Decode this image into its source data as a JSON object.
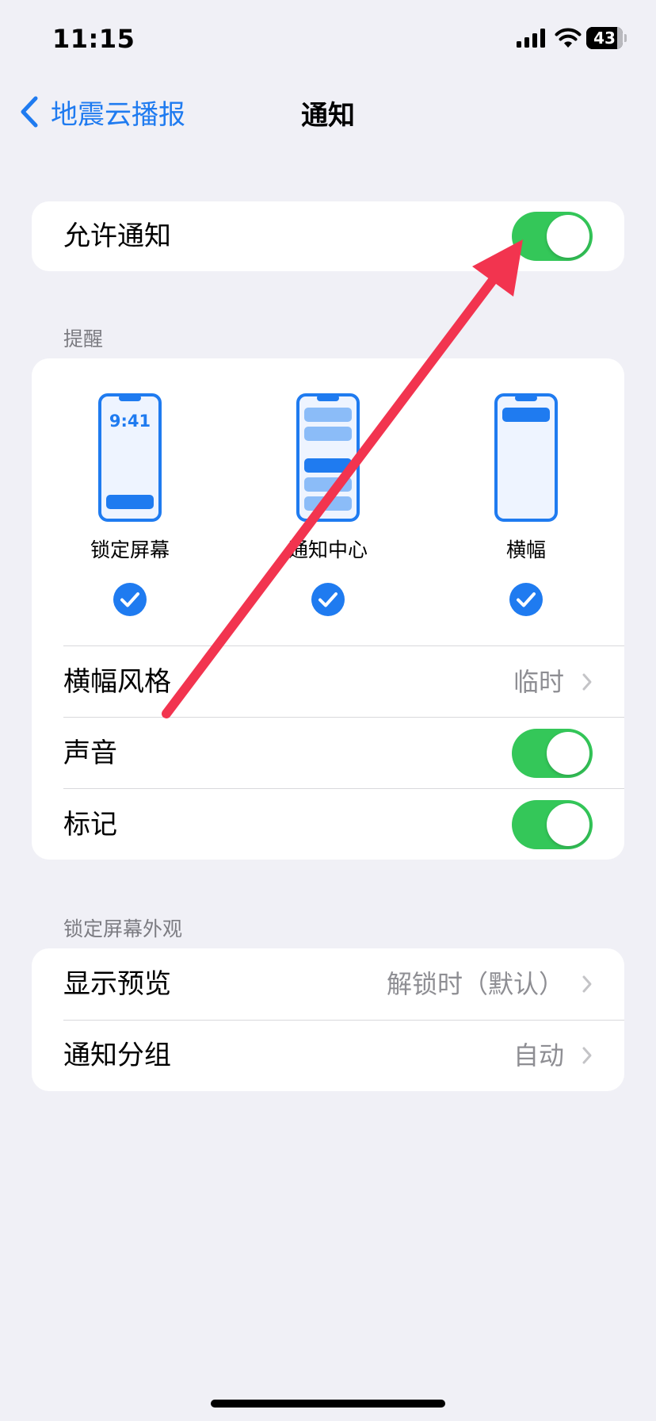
{
  "status_bar": {
    "time": "11:15",
    "battery_level": "43",
    "battery_fraction": 0.43,
    "icons": [
      "signal-icon",
      "wifi-icon",
      "battery-icon"
    ]
  },
  "nav": {
    "back_label": "地震云播报",
    "title": "通知"
  },
  "allow_notifications": {
    "label": "允许通知",
    "enabled": true
  },
  "alerts": {
    "header": "提醒",
    "styles": [
      {
        "label": "锁定屏幕",
        "phone_time": "9:41",
        "checked": true
      },
      {
        "label": "通知中心",
        "checked": true
      },
      {
        "label": "横幅",
        "checked": true
      }
    ],
    "banner_style": {
      "label": "横幅风格",
      "value": "临时"
    },
    "sounds": {
      "label": "声音",
      "enabled": true
    },
    "badges": {
      "label": "标记",
      "enabled": true
    }
  },
  "lock_screen_appearance": {
    "header": "锁定屏幕外观",
    "show_previews": {
      "label": "显示预览",
      "value": "解锁时（默认）"
    },
    "notification_grouping": {
      "label": "通知分组",
      "value": "自动"
    }
  },
  "colors": {
    "accent_blue": "#1f7bf0",
    "toggle_green": "#34c759",
    "annotation_red": "#f2344f",
    "background": "#f0f0f6"
  }
}
